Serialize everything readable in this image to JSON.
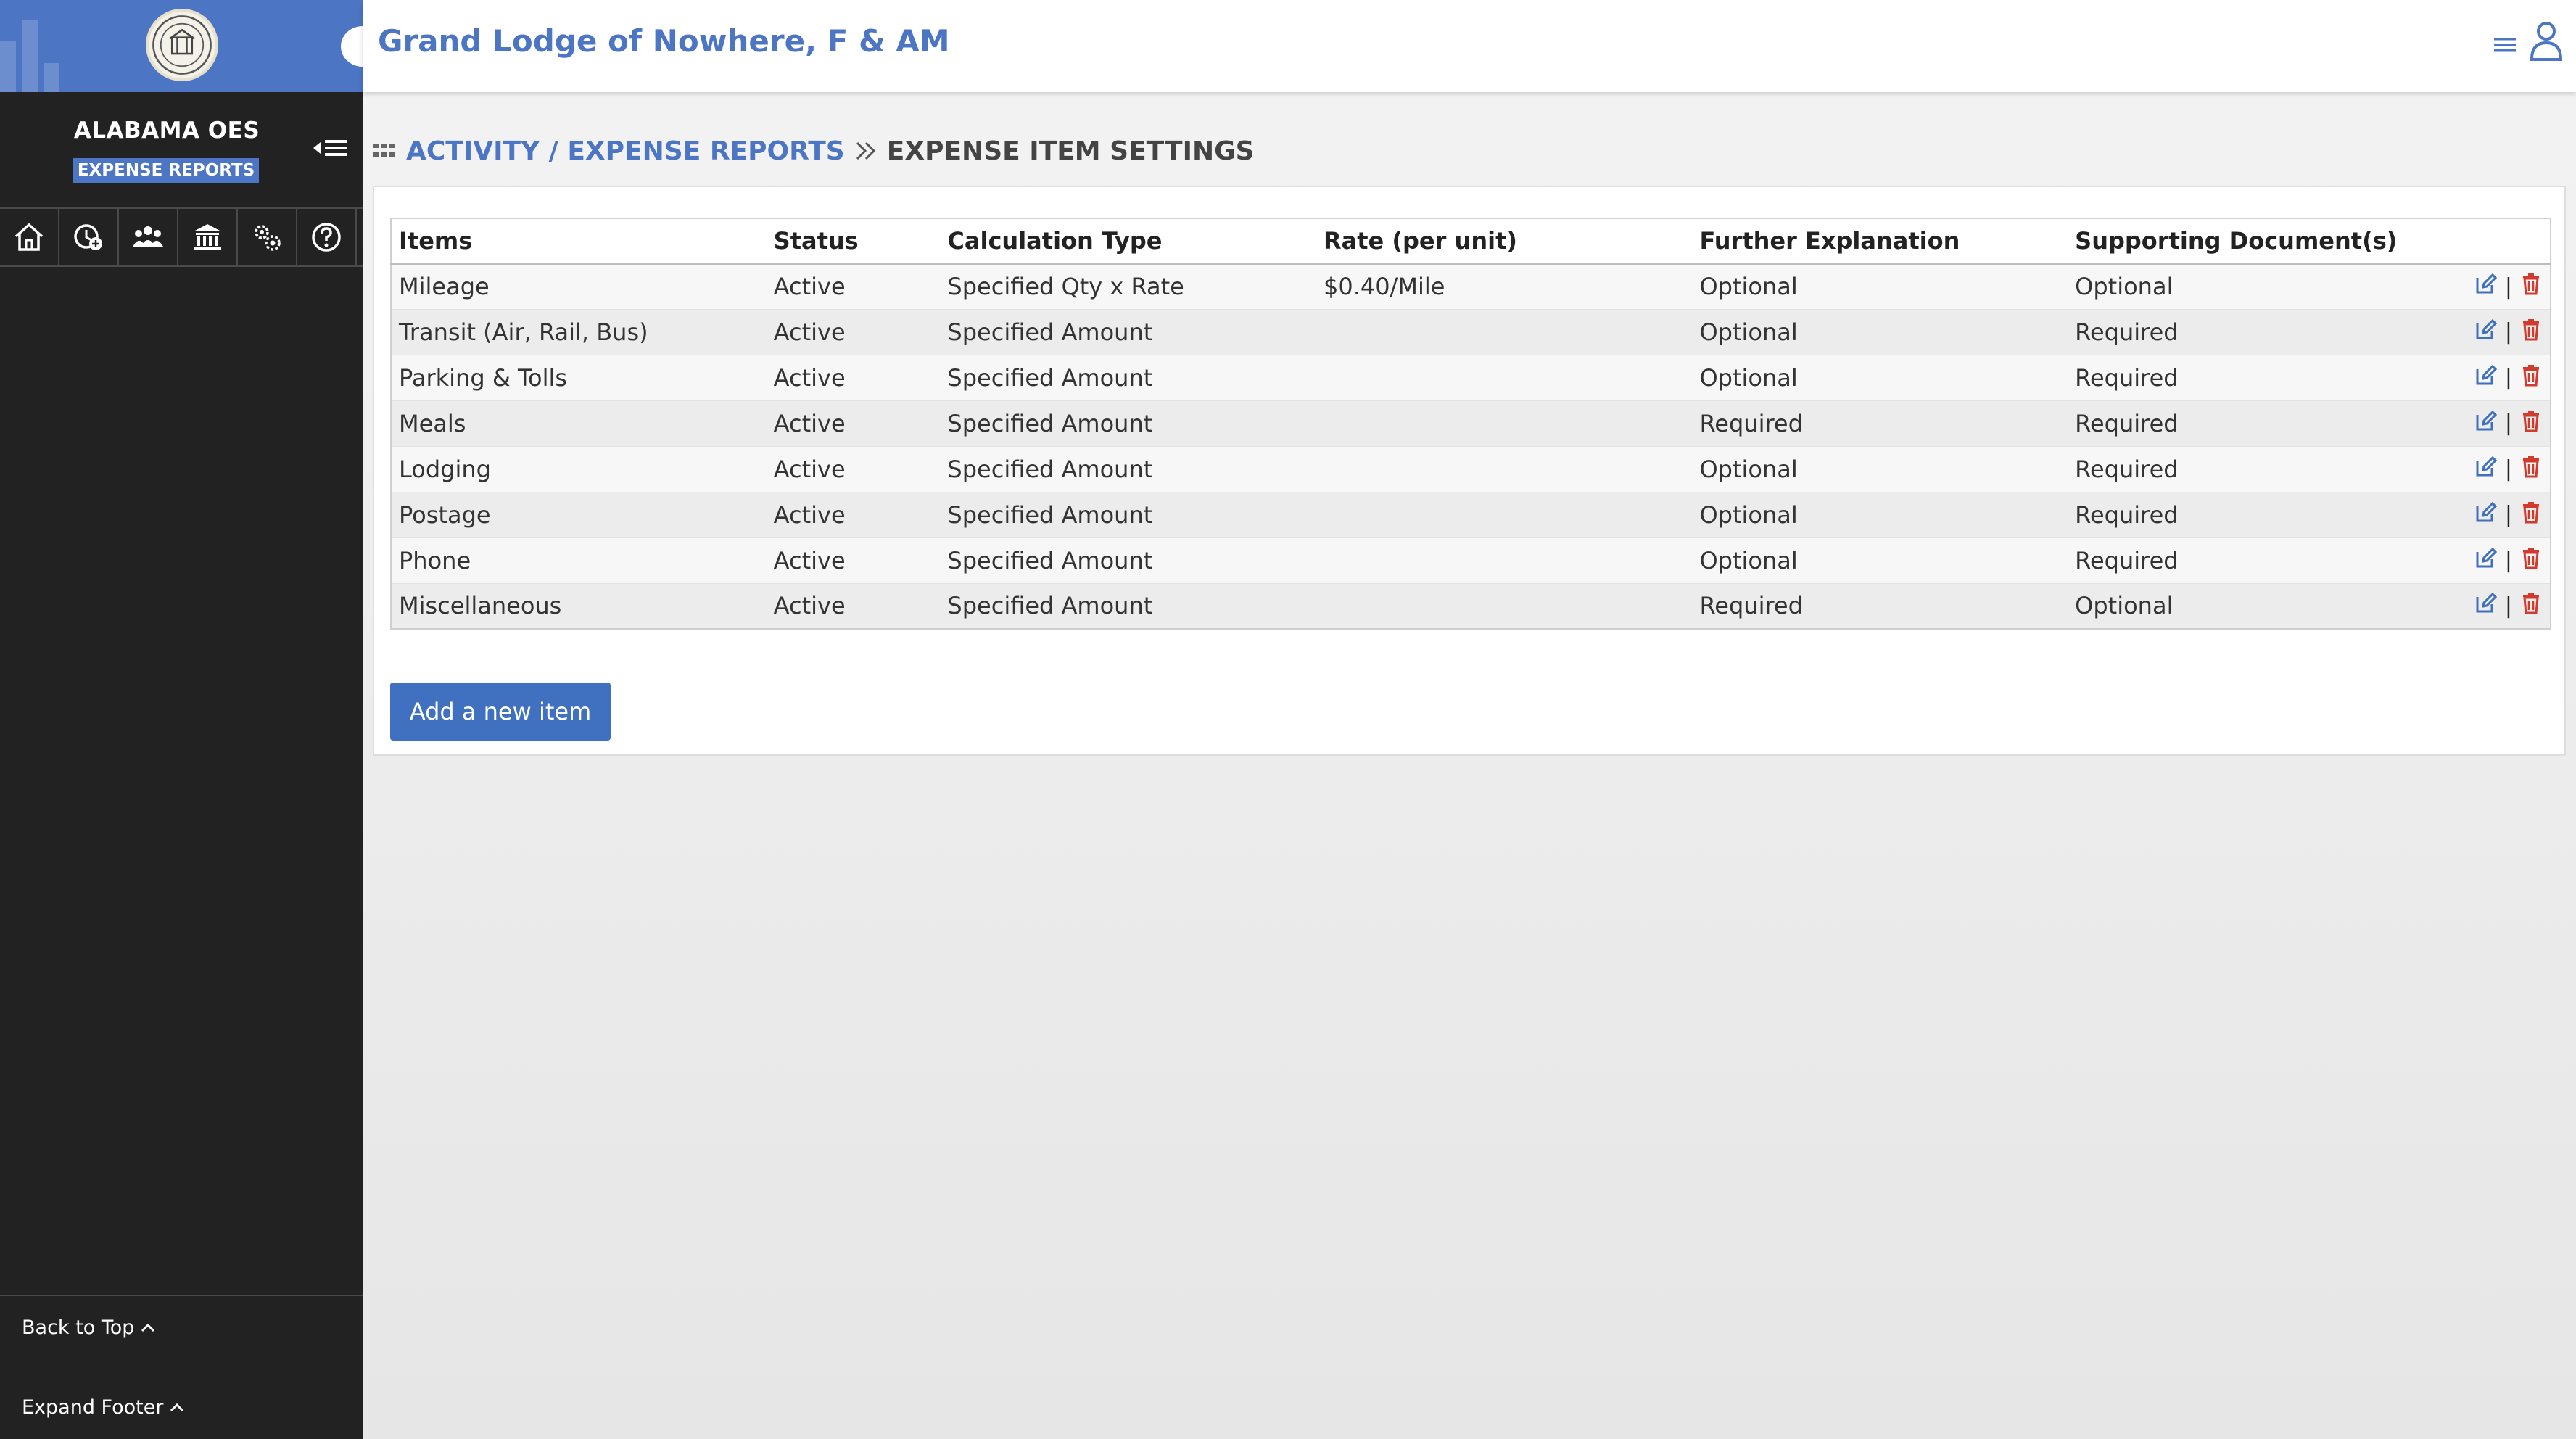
{
  "org_name": "Grand Lodge of Nowhere, F & AM",
  "sidebar": {
    "title": "ALABAMA OES",
    "badge": "EXPENSE REPORTS",
    "back_to_top": "Back to Top",
    "expand_footer": "Expand Footer",
    "nav_icons": [
      "home-icon",
      "clock-add-icon",
      "members-icon",
      "bank-icon",
      "gears-icon",
      "help-icon"
    ]
  },
  "breadcrumb": {
    "parent": "ACTIVITY / EXPENSE REPORTS",
    "current": "EXPENSE ITEM SETTINGS"
  },
  "table": {
    "headers": [
      "Items",
      "Status",
      "Calculation Type",
      "Rate (per unit)",
      "Further Explanation",
      "Supporting Document(s)"
    ],
    "rows": [
      {
        "item": "Mileage",
        "status": "Active",
        "calc": "Specified Qty x Rate",
        "rate": "$0.40/Mile",
        "explanation": "Optional",
        "docs": "Optional"
      },
      {
        "item": "Transit (Air, Rail, Bus)",
        "status": "Active",
        "calc": "Specified Amount",
        "rate": "",
        "explanation": "Optional",
        "docs": "Required"
      },
      {
        "item": "Parking & Tolls",
        "status": "Active",
        "calc": "Specified Amount",
        "rate": "",
        "explanation": "Optional",
        "docs": "Required"
      },
      {
        "item": "Meals",
        "status": "Active",
        "calc": "Specified Amount",
        "rate": "",
        "explanation": "Required",
        "docs": "Required"
      },
      {
        "item": "Lodging",
        "status": "Active",
        "calc": "Specified Amount",
        "rate": "",
        "explanation": "Optional",
        "docs": "Required"
      },
      {
        "item": "Postage",
        "status": "Active",
        "calc": "Specified Amount",
        "rate": "",
        "explanation": "Optional",
        "docs": "Required"
      },
      {
        "item": "Phone",
        "status": "Active",
        "calc": "Specified Amount",
        "rate": "",
        "explanation": "Optional",
        "docs": "Required"
      },
      {
        "item": "Miscellaneous",
        "status": "Active",
        "calc": "Specified Amount",
        "rate": "",
        "explanation": "Required",
        "docs": "Optional"
      }
    ]
  },
  "add_button_label": "Add a new item",
  "colors": {
    "brand_blue": "#4c76c4",
    "button_blue": "#4070c0",
    "required_red": "#d23a2e",
    "sidebar_bg": "#222222"
  }
}
